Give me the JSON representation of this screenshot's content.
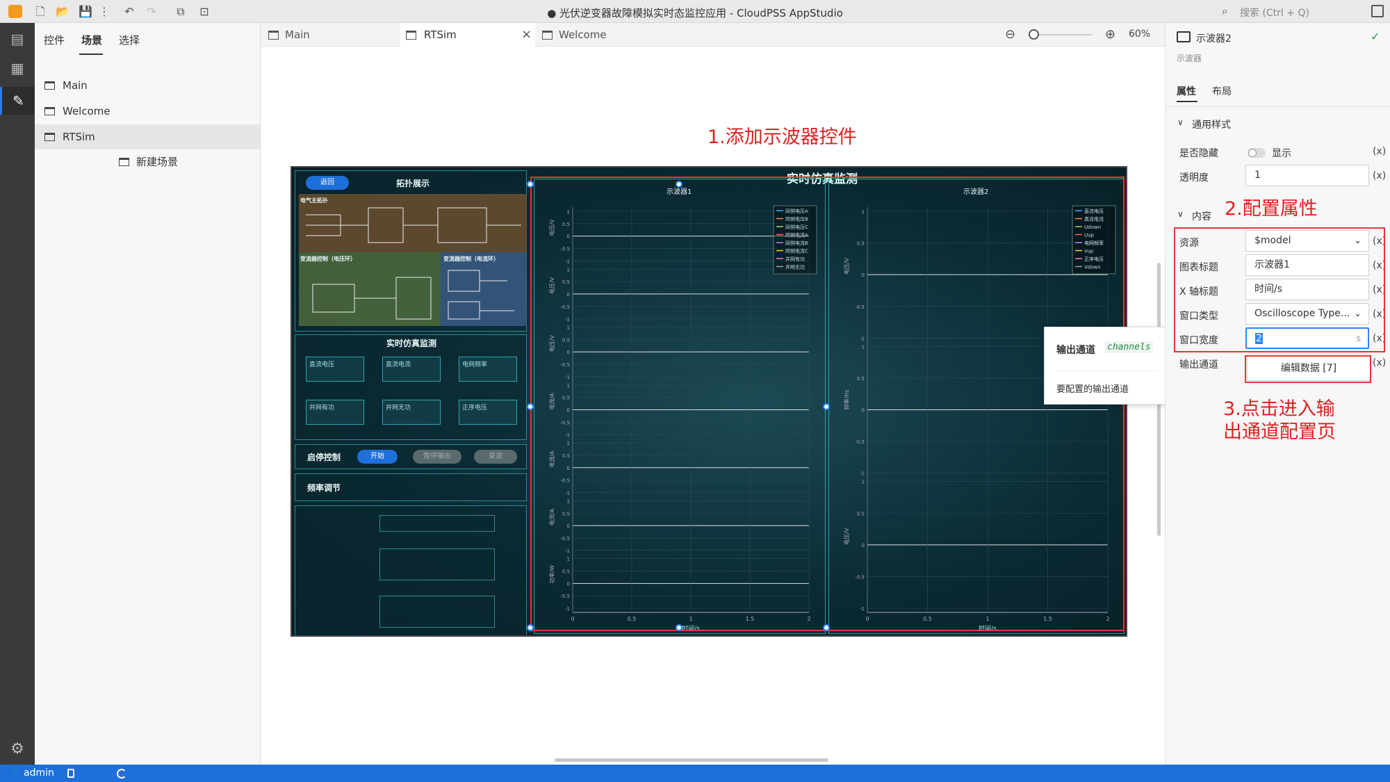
{
  "window": {
    "title": "● 光伏逆变器故障模拟实时态监控应用 - CloudPSS AppStudio"
  },
  "search": {
    "placeholder": "搜索 (Ctrl + Q)"
  },
  "left_panel": {
    "tabs": [
      "控件",
      "场景",
      "选择"
    ],
    "active_tab": "场景",
    "scenes": [
      {
        "label": "Main"
      },
      {
        "label": "Welcome"
      },
      {
        "label": "RTSim",
        "selected": true
      }
    ],
    "new_scene_label": "新建场景"
  },
  "editor": {
    "tabs": [
      {
        "label": "Main"
      },
      {
        "label": "RTSim",
        "active": true
      },
      {
        "label": "Welcome"
      }
    ],
    "zoom": "60%"
  },
  "annotations": {
    "step1": "1.添加示波器控件",
    "step2": "2.配置属性",
    "step3_line1": "3.点击进入输",
    "step3_line2": "出通道配置页"
  },
  "canvas": {
    "header_title": "实时仿真监测",
    "topology": {
      "back_btn": "返回",
      "title": "拓扑展示",
      "sub1": "电气主拓扑",
      "sub2": "变流器控制（电压环）",
      "sub3": "变流器控制（电流环）"
    },
    "monitor": {
      "title": "实时仿真监测",
      "cards": [
        "直流电压",
        "直流电流",
        "电网频率",
        "并网有功",
        "并网无功",
        "正序电压"
      ]
    },
    "control": {
      "title": "启停控制",
      "start": "开始",
      "pause": "暂停输出",
      "record": "录波"
    },
    "freq": {
      "title": "频率调节"
    },
    "scope1": {
      "title": "示波器1",
      "xlabel": "时间/s",
      "xticks": [
        "0",
        "0.5",
        "1",
        "1.5",
        "2"
      ],
      "ylabels": [
        "电压/V",
        "电压/V",
        "电压/V",
        "电流/A",
        "电流/A",
        "电流/A",
        "功率/W"
      ],
      "yticks": [
        "1",
        "0.5",
        "0",
        "-0.5",
        "-1"
      ],
      "legend": [
        "同侧电压A",
        "同侧电压B",
        "同侧电压C",
        "同侧电流A",
        "同侧电流B",
        "同侧电流C",
        "并网有功",
        "并网无功"
      ]
    },
    "scope2": {
      "title": "示波器2",
      "xlabel": "时间/s",
      "xticks": [
        "0",
        "0.5",
        "1",
        "1.5",
        "2"
      ],
      "ylabels": [
        "电压/V",
        "频率/Hz",
        "电压/V"
      ],
      "yticks": [
        "1",
        "0.5",
        "0",
        "-0.5",
        "-1"
      ],
      "legend": [
        "直流电压",
        "直流电流",
        "Udown",
        "Uup",
        "电网频率",
        "Vup",
        "正序电压",
        "Vdown"
      ]
    }
  },
  "popover": {
    "title": "输出通道",
    "key": "channels",
    "description": "要配置的输出通道"
  },
  "right_panel": {
    "component_name": "示波器2",
    "component_type": "示波器",
    "tabs": [
      "属性",
      "布局"
    ],
    "sections": {
      "common": "通用样式",
      "content": "内容"
    },
    "fields": {
      "hidden": {
        "label": "是否隐藏",
        "toggle_label": "显示"
      },
      "opacity": {
        "label": "透明度",
        "value": "1"
      },
      "source": {
        "label": "资源",
        "value": "$model"
      },
      "chart_title": {
        "label": "图表标题",
        "value": "示波器1"
      },
      "x_title": {
        "label": "X 轴标题",
        "value": "时间/s"
      },
      "window_type": {
        "label": "窗口类型",
        "value": "Oscilloscope Type..."
      },
      "window_width": {
        "label": "窗口宽度",
        "value": "2",
        "unit": "s"
      },
      "output_channels": {
        "label": "输出通道",
        "button": "编辑数据 [7]"
      }
    },
    "x_symbol": "(x)"
  },
  "status": {
    "user": "admin"
  },
  "colors": {
    "accent": "#1e6fd9",
    "annotation": "#e02020",
    "canvas_bg": "#0b2a33"
  }
}
